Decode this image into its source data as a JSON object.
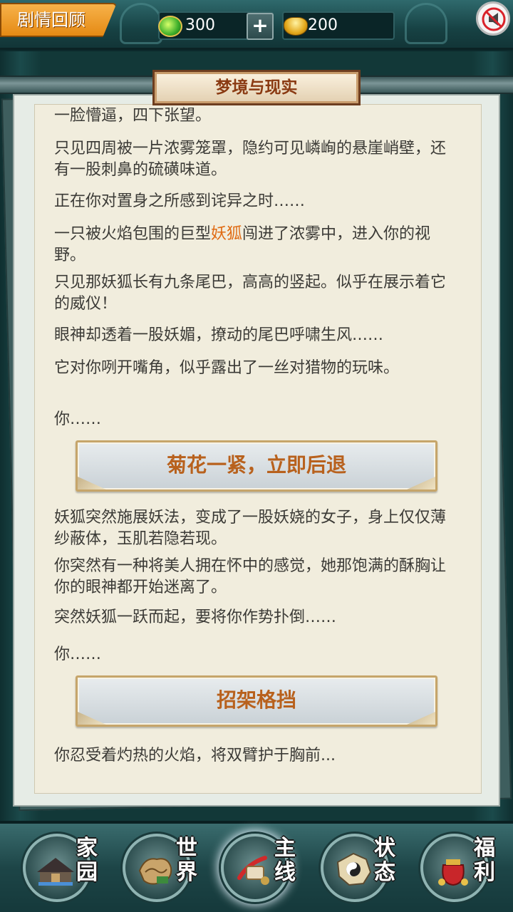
{
  "header": {
    "recap_label": "剧情回顾",
    "jade_amount": "300",
    "plus_label": "+",
    "gold_amount": "200"
  },
  "chapter": {
    "title": "梦境与现实"
  },
  "story": {
    "p0": "一脸懵逼，四下张望。",
    "p1": "只见四周被一片浓雾笼罩，隐约可见嶙峋的悬崖峭壁，还有一股刺鼻的硫磺味道。",
    "p2": "正在你对置身之所感到诧异之时……",
    "p3_before": "一只被火焰包围的巨型",
    "p3_highlight": "妖狐",
    "p3_after": "闯进了浓雾中，进入你的视野。",
    "p4": "只见那妖狐长有九条尾巴，高高的竖起。似乎在展示着它的威仪！",
    "p5": "眼神却透着一股妖媚，撩动的尾巴呼啸生风……",
    "p6": "它对你咧开嘴角，似乎露出了一丝对猎物的玩味。",
    "p7": "你……",
    "choice1": "菊花一紧，立即后退",
    "p8": "妖狐突然施展妖法，变成了一股妖娆的女子，身上仅仅薄纱蔽体，玉肌若隐若现。",
    "p9": "你突然有一种将美人拥在怀中的感觉，她那饱满的酥胸让你的眼神都开始迷离了。",
    "p10": "突然妖狐一跃而起，要将你作势扑倒……",
    "p11": "你……",
    "choice2": "招架格挡",
    "p12": "你忍受着灼热的火焰，将双臂护于胸前..."
  },
  "nav": {
    "home": "家园",
    "world": "世界",
    "main": "主线",
    "status": "状态",
    "welfare": "福利"
  },
  "colors": {
    "highlight": "#e06a12",
    "choice_text": "#b8611d",
    "accent_orange": "#e58a14"
  }
}
